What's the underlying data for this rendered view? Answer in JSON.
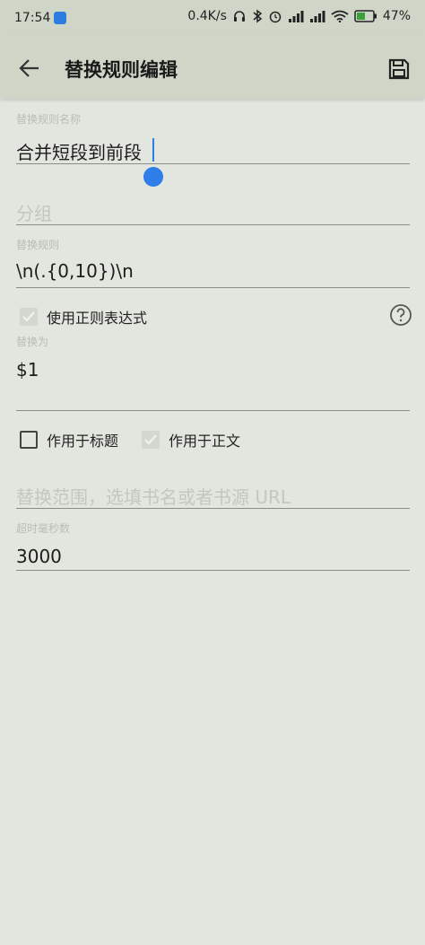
{
  "status_bar": {
    "time": "17:54",
    "net_speed": "0.4K/s",
    "battery": "47%",
    "icons": [
      "headset-icon",
      "bluetooth-icon",
      "alarm-icon",
      "signal-icon",
      "hd-signal-icon",
      "wifi-icon",
      "battery-icon"
    ]
  },
  "app_bar": {
    "title": "替换规则编辑",
    "back_icon": "arrow-left-icon",
    "save_icon": "save-icon"
  },
  "form": {
    "rule_name": {
      "label": "替换规则名称",
      "value": "合并短段到前段"
    },
    "group": {
      "placeholder": "分组"
    },
    "pattern": {
      "label": "替换规则",
      "value": "\\n(.{0,10})\\n"
    },
    "use_regex": {
      "label": "使用正则表达式",
      "checked": true
    },
    "replacement": {
      "label": "替换为",
      "value": "$1"
    },
    "apply_title": {
      "label": "作用于标题",
      "checked": false
    },
    "apply_content": {
      "label": "作用于正文",
      "checked": true
    },
    "scope": {
      "placeholder": "替换范围，选填书名或者书源 URL"
    },
    "timeout": {
      "label": "超时毫秒数",
      "value": "3000"
    }
  },
  "colors": {
    "background": "#e3e6df",
    "app_bar": "#cfd6c8",
    "accent": "#2f7de8"
  }
}
